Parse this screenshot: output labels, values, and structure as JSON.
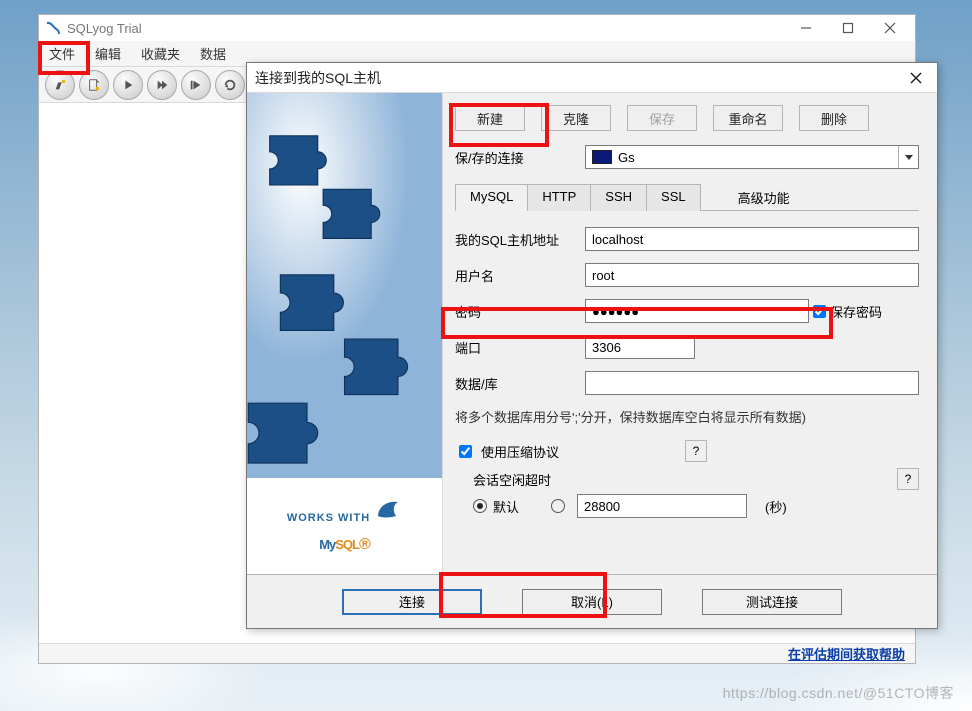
{
  "app": {
    "title": "SQLyog Trial"
  },
  "menu": {
    "file": "文件",
    "edit": "编辑",
    "favorites": "收藏夹",
    "database": "数据"
  },
  "status": {
    "help_link": "在评估期间获取帮助"
  },
  "dialog": {
    "title": "连接到我的SQL主机",
    "buttons": {
      "new": "新建",
      "clone": "克隆",
      "save": "保存",
      "rename": "重命名",
      "delete": "删除"
    },
    "saved_conn": {
      "label": "保/存的连接",
      "value": "Gs"
    },
    "tabs": {
      "mysql": "MySQL",
      "http": "HTTP",
      "ssh": "SSH",
      "ssl": "SSL",
      "advanced": "高级功能"
    },
    "form": {
      "host_label": "我的SQL主机地址",
      "host_value": "localhost",
      "user_label": "用户名",
      "user_value": "root",
      "pwd_label": "密码",
      "pwd_value": "●●●●●●",
      "save_pwd": "保存密码",
      "port_label": "端口",
      "port_value": "3306",
      "db_label": "数据/库",
      "db_value": "",
      "db_hint": "将多个数据库用分号';'分开，保持数据库空白将显示所有数据)",
      "compress": "使用压缩协议",
      "idle_label": "会话空闲超时",
      "default_radio": "默认",
      "custom_value": "28800",
      "unit": "(秒)"
    },
    "footer": {
      "connect": "连接",
      "cancel": "取消(L)",
      "test": "测试连接"
    }
  },
  "logo": {
    "works_with": "WORKS WITH",
    "my": "My",
    "sql": "SQL"
  },
  "watermark": "https://blog.csdn.net/@51CTO博客"
}
